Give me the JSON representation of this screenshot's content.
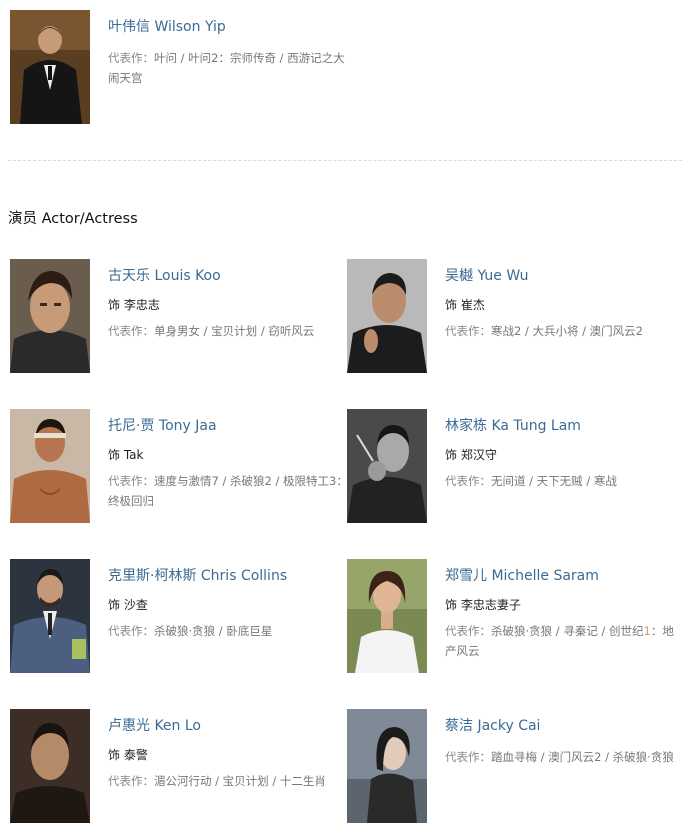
{
  "director": {
    "name": "叶伟信 Wilson Yip",
    "works_label": "代表作：",
    "works": "叶问 / 叶问2：宗师传奇 / 西游记之大闹天宫"
  },
  "cast_section": {
    "title": "演员 Actor/Actress"
  },
  "actors": [
    {
      "name": "古天乐 Louis Koo",
      "role": "饰 李忠志",
      "works_label": "代表作：",
      "works": "单身男女 / 宝贝计划 / 窃听风云"
    },
    {
      "name": "吴樾 Yue Wu",
      "role": "饰 崔杰",
      "works_label": "代表作：",
      "works": "寒战2 / 大兵小将 / 澳门风云2"
    },
    {
      "name": "托尼·贾 Tony Jaa",
      "role": "饰 Tak",
      "works_label": "代表作：",
      "works": "速度与激情7 / 杀破狼2 / 极限特工3：终极回归"
    },
    {
      "name": "林家栋 Ka Tung Lam",
      "role": "饰 郑汉守",
      "works_label": "代表作：",
      "works": "无间道 / 天下无贼 / 寒战"
    },
    {
      "name": "克里斯·柯林斯 Chris Collins",
      "role": "饰 沙查",
      "works_label": "代表作：",
      "works": "杀破狼·贪狼 / 卧底巨星"
    },
    {
      "name": "郑雪儿 Michelle Saram",
      "role": "饰 李忠志妻子",
      "works_label": "代表作：",
      "works_a": "杀破狼·贪狼 / 寻秦记 / 创世纪",
      "works_hl": "1",
      "works_b": "：地产风云"
    },
    {
      "name": "卢惠光 Ken Lo",
      "role": "饰 泰警",
      "works_label": "代表作：",
      "works": "湄公河行动 / 宝贝计划 / 十二生肖"
    },
    {
      "name": "蔡洁 Jacky Cai",
      "works_label": "代表作：",
      "works": "踏血寻梅 / 澳门风云2 / 杀破狼·贪狼"
    }
  ],
  "colors": {
    "name_link": "#3b6b94",
    "works_text": "#777777",
    "divider": "#d9d9d9",
    "highlight": "#c9a060"
  }
}
